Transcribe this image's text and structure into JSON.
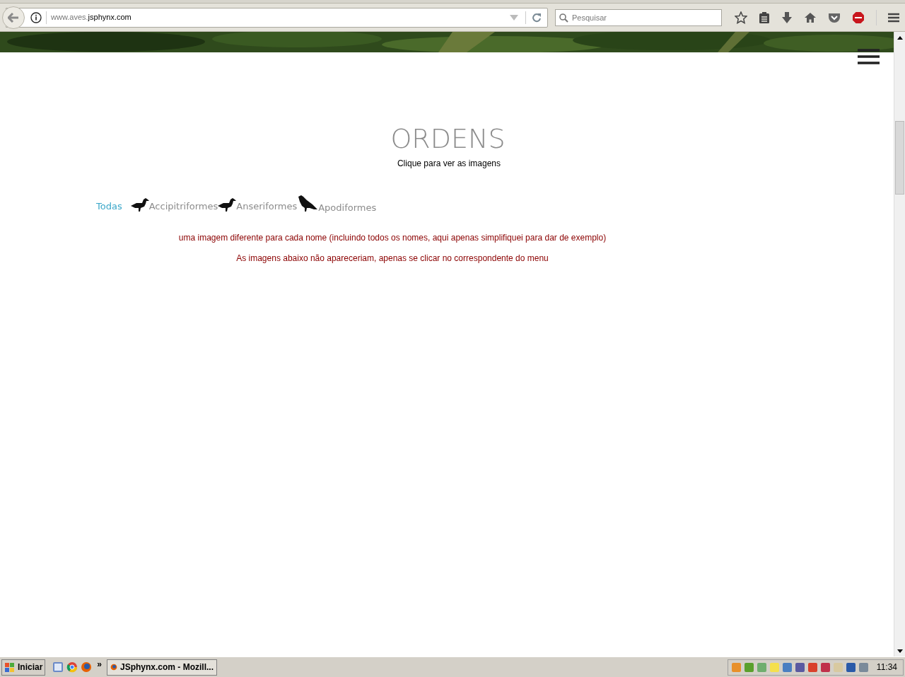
{
  "browser": {
    "url_prefix": "www.aves.",
    "url_domain": "jsphynx.com",
    "search": {
      "placeholder": "Pesquisar"
    }
  },
  "page": {
    "title": "ORDENS",
    "subtitle": "Clique para ver as imagens",
    "filters": [
      {
        "label": "Todas",
        "kind": "all",
        "selected": true
      },
      {
        "label": "Accipitriformes",
        "kind": "order",
        "selected": false
      },
      {
        "label": "Anseriformes",
        "kind": "order",
        "selected": false
      },
      {
        "label": "Apodiformes",
        "kind": "order",
        "selected": false
      }
    ],
    "notes": [
      "uma imagem diferente para cada nome (incluindo todos os nomes, aqui apenas simplifiquei para dar de exemplo)",
      "As imagens abaixo não apareceriam, apenas se clicar no correspondente do menu"
    ]
  },
  "taskbar": {
    "start": "Iniciar",
    "quick_more": "»",
    "task": "JSphynx.com - Mozill...",
    "clock": "11:34"
  }
}
